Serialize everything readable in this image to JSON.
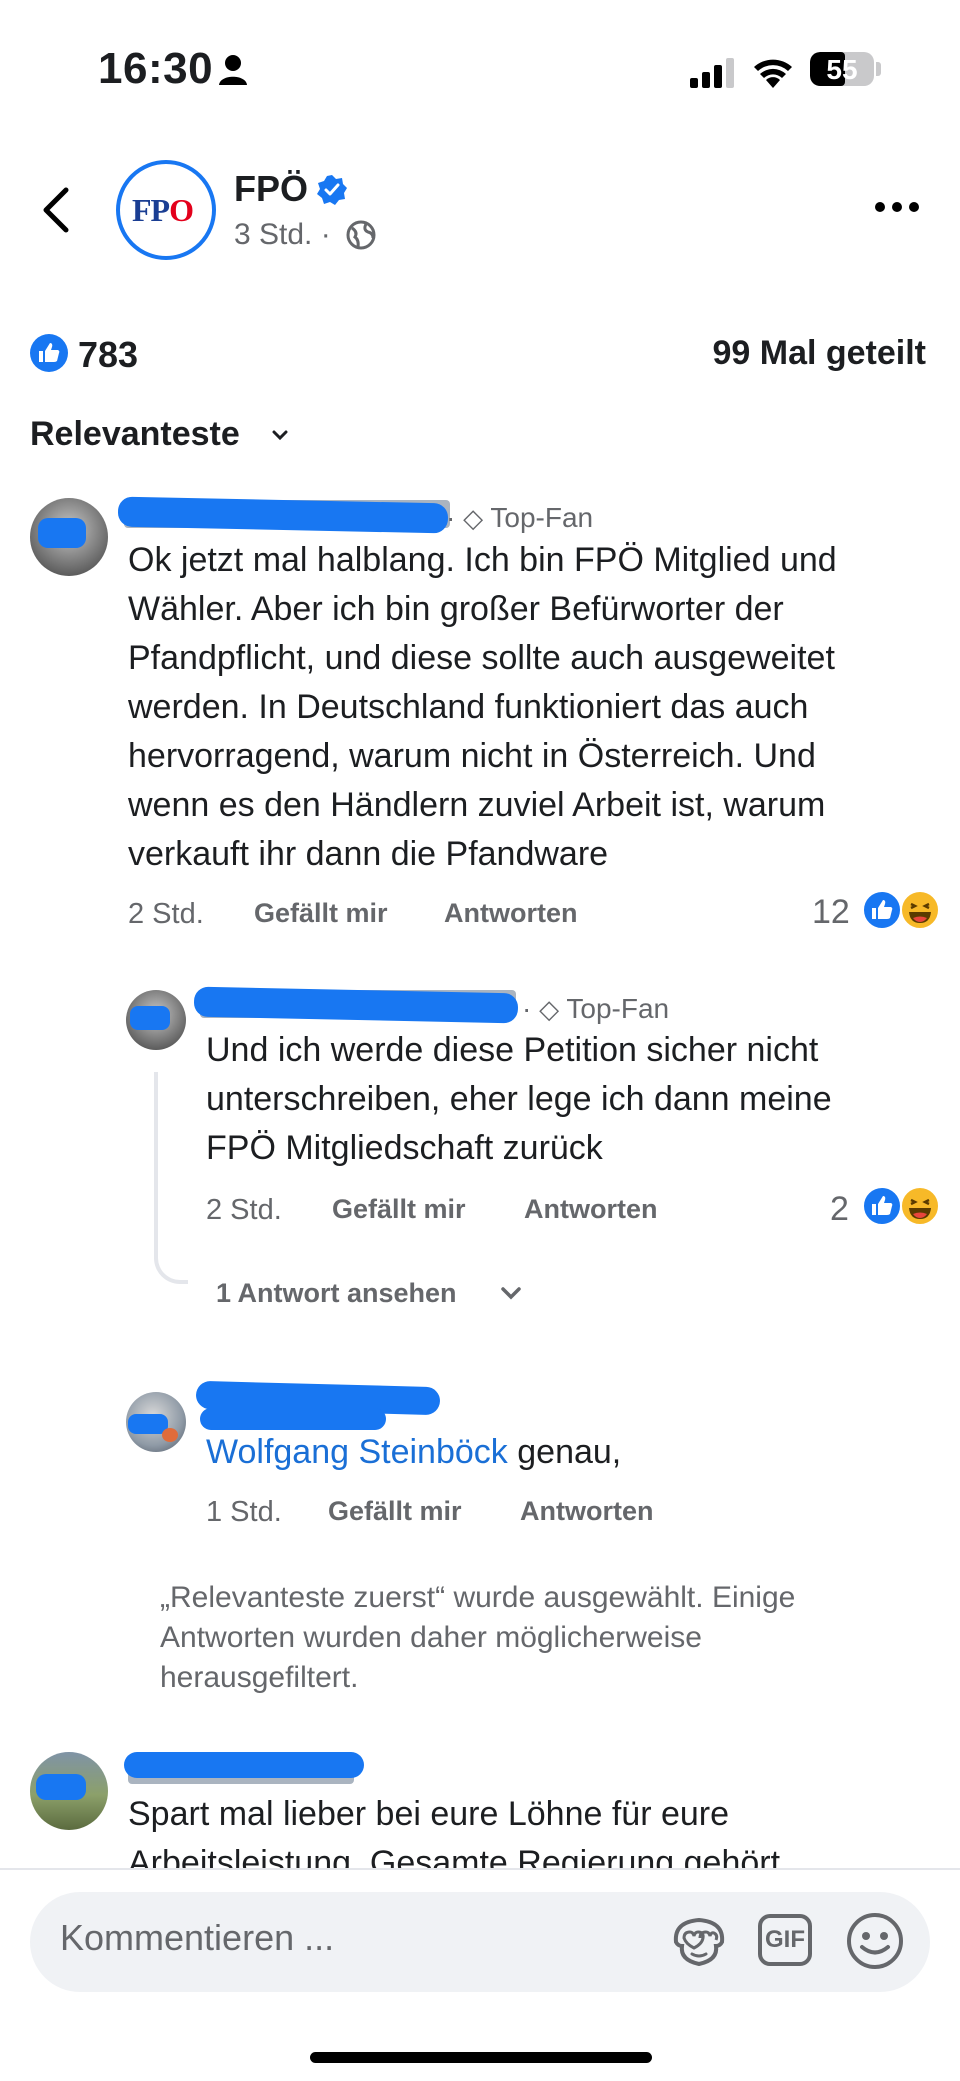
{
  "status_bar": {
    "time": "16:30",
    "battery": "55",
    "battery_level": 0.55
  },
  "post_header": {
    "page_name": "FPÖ",
    "logo_text": "FPO",
    "time": "3 Std.",
    "separator": "·"
  },
  "post_stats": {
    "reactions": "783",
    "shares": "99 Mal geteilt"
  },
  "sort": {
    "label": "Relevanteste"
  },
  "comments": [
    {
      "badge": "Top-Fan",
      "text": [
        "Ok jetzt mal halblang. Ich bin FPÖ Mitglied und",
        "Wähler. Aber ich bin großer Befürworter der",
        "Pfandpflicht, und diese sollte auch ausgeweitet",
        "werden. In Deutschland funktioniert das auch",
        "hervorragend, warum nicht in Österreich. Und",
        "wenn es den Händlern zuviel Arbeit ist, warum",
        "verkauft ihr dann die Pfandware"
      ],
      "time": "2 Std.",
      "like": "Gefällt mir",
      "reply": "Antworten",
      "reactions": "12"
    },
    {
      "badge": "Top-Fan",
      "text": [
        "Und ich werde diese Petition sicher nicht",
        "unterschreiben, eher lege ich dann meine",
        "FPÖ Mitgliedschaft zurück"
      ],
      "time": "2 Std.",
      "like": "Gefällt mir",
      "reply": "Antworten",
      "reactions": "2",
      "view_replies": "1 Antwort ansehen"
    },
    {
      "mention": "Wolfgang Steinböck",
      "text": "genau,",
      "time": "1 Std.",
      "like": "Gefällt mir",
      "reply": "Antworten"
    },
    {
      "text": [
        "Spart mal lieber bei eure Löhne für eure",
        "Arbeitsleistung. Gesamte Regierung gehört"
      ]
    }
  ],
  "filter_notice": "„Relevanteste zuerst“ wurde ausgewählt. Einige Antworten wurden daher möglicherweise herausgefiltert.",
  "composer": {
    "placeholder": "Kommentieren ...",
    "gif_label": "GIF"
  },
  "colors": {
    "accent": "#1877f2",
    "mention": "#1a6fd6",
    "secondary_text": "#65676b",
    "haha": "#f7b928"
  }
}
